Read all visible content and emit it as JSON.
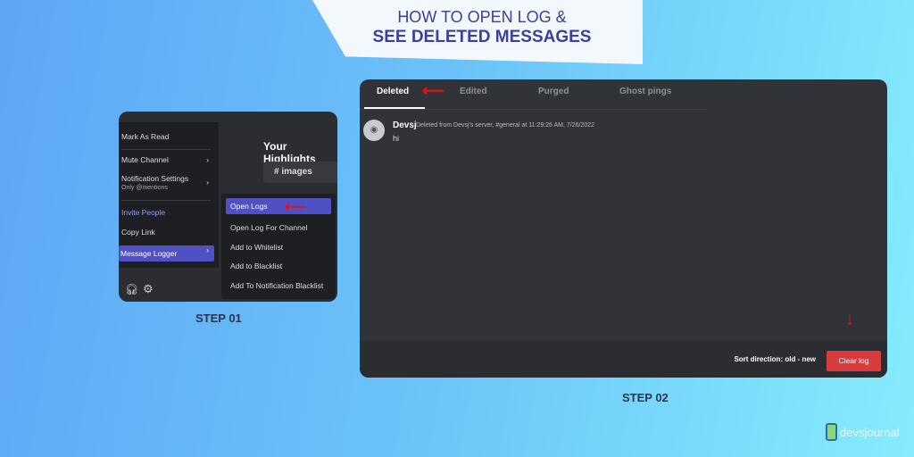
{
  "banner": {
    "line1": "HOW TO OPEN LOG &",
    "line2": "SEE DELETED MESSAGES"
  },
  "step1": {
    "label": "STEP 01",
    "highlights": "Your Highlights",
    "channel": "# images",
    "menu": [
      {
        "label": "Mark As Read"
      },
      {
        "label": "Mute Channel"
      },
      {
        "label": "Notification Settings",
        "sub": "Only @mentions"
      },
      {
        "label": "Invite People"
      },
      {
        "label": "Copy Link"
      },
      {
        "label": "Message Logger"
      }
    ],
    "submenu": [
      "Open Logs",
      "Open Log For Channel",
      "Add to Whitelist",
      "Add to Blacklist",
      "Add To Notification Blacklist"
    ]
  },
  "step2": {
    "label": "STEP 02",
    "tabs": [
      "Deleted",
      "Edited",
      "Purged",
      "Ghost pings"
    ],
    "active_tab": "Deleted",
    "message": {
      "user": "Devsj",
      "meta": "Deleted from Devsj's server, #general at 11:29:26 AM, 7/26/2022",
      "text": "hi"
    },
    "sort": "Sort direction: old - new",
    "clear": "Clear log"
  },
  "brand": "devsjournal",
  "colors": {
    "accent": "#4e50c4",
    "danger": "#d83c3e",
    "arrow": "#e0161b"
  }
}
